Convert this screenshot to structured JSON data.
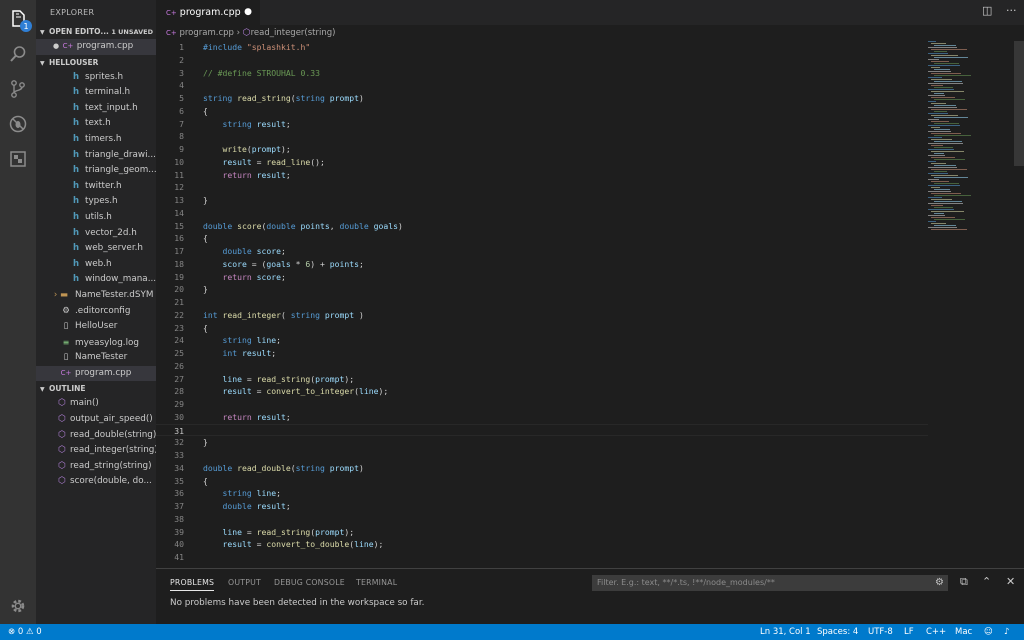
{
  "activity": {
    "explorer_badge": "1",
    "icons": [
      "files-icon",
      "search-icon",
      "source-control-icon",
      "debug-icon",
      "extensions-icon",
      "gear-icon"
    ]
  },
  "sidebar": {
    "title": "EXPLORER",
    "open_editors": {
      "label": "OPEN EDITO...",
      "unsaved": "1 UNSAVED",
      "file": "program.cpp"
    },
    "project": "HELLOUSER",
    "files": [
      {
        "name": "sprites.h",
        "icon": "h"
      },
      {
        "name": "terminal.h",
        "icon": "h"
      },
      {
        "name": "text_input.h",
        "icon": "h"
      },
      {
        "name": "text.h",
        "icon": "h"
      },
      {
        "name": "timers.h",
        "icon": "h"
      },
      {
        "name": "triangle_drawi...",
        "icon": "h"
      },
      {
        "name": "triangle_geom...",
        "icon": "h"
      },
      {
        "name": "twitter.h",
        "icon": "h"
      },
      {
        "name": "types.h",
        "icon": "h"
      },
      {
        "name": "utils.h",
        "icon": "h"
      },
      {
        "name": "vector_2d.h",
        "icon": "h"
      },
      {
        "name": "web_server.h",
        "icon": "h"
      },
      {
        "name": "web.h",
        "icon": "h"
      },
      {
        "name": "window_mana...",
        "icon": "h"
      },
      {
        "name": "NameTester.dSYM",
        "icon": "folder"
      },
      {
        "name": ".editorconfig",
        "icon": "gear"
      },
      {
        "name": "HelloUser",
        "icon": "file"
      },
      {
        "name": "myeasylog.log",
        "icon": "log"
      },
      {
        "name": "NameTester",
        "icon": "file"
      },
      {
        "name": "program.cpp",
        "icon": "cpp"
      }
    ],
    "outline_label": "OUTLINE",
    "outline": [
      "main()",
      "output_air_speed()",
      "read_double(string)",
      "read_integer(string)",
      "read_string(string)",
      "score(double, do..."
    ]
  },
  "tab": {
    "title": "program.cpp"
  },
  "breadcrumb": {
    "file": "program.cpp",
    "symbol": "read_integer(string)"
  },
  "editor": {
    "current_line": 31,
    "lines": [
      [
        [
          "k",
          "#include "
        ],
        [
          "s",
          "\"splashkit.h\""
        ]
      ],
      [],
      [
        [
          "c",
          "// #define STROUHAL 0.33"
        ]
      ],
      [],
      [
        [
          "k",
          "string "
        ],
        [
          "f",
          "read_string"
        ],
        [
          "t",
          "("
        ],
        [
          "k",
          "string "
        ],
        [
          "p",
          "prompt"
        ],
        [
          "t",
          ")"
        ]
      ],
      [
        [
          "t",
          "{"
        ]
      ],
      [
        [
          "t",
          "    "
        ],
        [
          "k",
          "string "
        ],
        [
          "p",
          "result"
        ],
        [
          "t",
          ";"
        ]
      ],
      [],
      [
        [
          "t",
          "    "
        ],
        [
          "f",
          "write"
        ],
        [
          "t",
          "("
        ],
        [
          "p",
          "prompt"
        ],
        [
          "t",
          ");"
        ]
      ],
      [
        [
          "t",
          "    "
        ],
        [
          "p",
          "result"
        ],
        [
          "t",
          " = "
        ],
        [
          "f",
          "read_line"
        ],
        [
          "t",
          "();"
        ]
      ],
      [
        [
          "t",
          "    "
        ],
        [
          "ctl",
          "return "
        ],
        [
          "p",
          "result"
        ],
        [
          "t",
          ";"
        ]
      ],
      [],
      [
        [
          "t",
          "}"
        ]
      ],
      [],
      [
        [
          "k",
          "double "
        ],
        [
          "f",
          "score"
        ],
        [
          "t",
          "("
        ],
        [
          "k",
          "double "
        ],
        [
          "p",
          "points"
        ],
        [
          "t",
          ", "
        ],
        [
          "k",
          "double "
        ],
        [
          "p",
          "goals"
        ],
        [
          "t",
          ")"
        ]
      ],
      [
        [
          "t",
          "{"
        ]
      ],
      [
        [
          "t",
          "    "
        ],
        [
          "k",
          "double "
        ],
        [
          "p",
          "score"
        ],
        [
          "t",
          ";"
        ]
      ],
      [
        [
          "t",
          "    "
        ],
        [
          "p",
          "score"
        ],
        [
          "t",
          " = ("
        ],
        [
          "p",
          "goals"
        ],
        [
          "t",
          " * "
        ],
        [
          "n",
          "6"
        ],
        [
          "t",
          ") + "
        ],
        [
          "p",
          "points"
        ],
        [
          "t",
          ";"
        ]
      ],
      [
        [
          "t",
          "    "
        ],
        [
          "ctl",
          "return "
        ],
        [
          "p",
          "score"
        ],
        [
          "t",
          ";"
        ]
      ],
      [
        [
          "t",
          "}"
        ]
      ],
      [],
      [
        [
          "k",
          "int "
        ],
        [
          "f",
          "read_integer"
        ],
        [
          "t",
          "( "
        ],
        [
          "k",
          "string "
        ],
        [
          "p",
          "prompt"
        ],
        [
          "t",
          " )"
        ]
      ],
      [
        [
          "t",
          "{"
        ]
      ],
      [
        [
          "t",
          "    "
        ],
        [
          "k",
          "string "
        ],
        [
          "p",
          "line"
        ],
        [
          "t",
          ";"
        ]
      ],
      [
        [
          "t",
          "    "
        ],
        [
          "k",
          "int "
        ],
        [
          "p",
          "result"
        ],
        [
          "t",
          ";"
        ]
      ],
      [],
      [
        [
          "t",
          "    "
        ],
        [
          "p",
          "line"
        ],
        [
          "t",
          " = "
        ],
        [
          "f",
          "read_string"
        ],
        [
          "t",
          "("
        ],
        [
          "p",
          "prompt"
        ],
        [
          "t",
          ");"
        ]
      ],
      [
        [
          "t",
          "    "
        ],
        [
          "p",
          "result"
        ],
        [
          "t",
          " = "
        ],
        [
          "f",
          "convert_to_integer"
        ],
        [
          "t",
          "("
        ],
        [
          "p",
          "line"
        ],
        [
          "t",
          ");"
        ]
      ],
      [],
      [
        [
          "t",
          "    "
        ],
        [
          "ctl",
          "return "
        ],
        [
          "p",
          "result"
        ],
        [
          "t",
          ";"
        ]
      ],
      [],
      [
        [
          "t",
          "}"
        ]
      ],
      [],
      [
        [
          "k",
          "double "
        ],
        [
          "f",
          "read_double"
        ],
        [
          "t",
          "("
        ],
        [
          "k",
          "string "
        ],
        [
          "p",
          "prompt"
        ],
        [
          "t",
          ")"
        ]
      ],
      [
        [
          "t",
          "{"
        ]
      ],
      [
        [
          "t",
          "    "
        ],
        [
          "k",
          "string "
        ],
        [
          "p",
          "line"
        ],
        [
          "t",
          ";"
        ]
      ],
      [
        [
          "t",
          "    "
        ],
        [
          "k",
          "double "
        ],
        [
          "p",
          "result"
        ],
        [
          "t",
          ";"
        ]
      ],
      [],
      [
        [
          "t",
          "    "
        ],
        [
          "p",
          "line"
        ],
        [
          "t",
          " = "
        ],
        [
          "f",
          "read_string"
        ],
        [
          "t",
          "("
        ],
        [
          "p",
          "prompt"
        ],
        [
          "t",
          ");"
        ]
      ],
      [
        [
          "t",
          "    "
        ],
        [
          "p",
          "result"
        ],
        [
          "t",
          " = "
        ],
        [
          "f",
          "convert_to_double"
        ],
        [
          "t",
          "("
        ],
        [
          "p",
          "line"
        ],
        [
          "t",
          ");"
        ]
      ],
      []
    ]
  },
  "panel": {
    "tabs": [
      "PROBLEMS",
      "OUTPUT",
      "DEBUG CONSOLE",
      "TERMINAL"
    ],
    "active_tab": "PROBLEMS",
    "filter_placeholder": "Filter. E.g.: text, **/*.ts, !**/node_modules/**",
    "message": "No problems have been detected in the workspace so far."
  },
  "status": {
    "errors": "0",
    "warnings": "0",
    "position": "Ln 31, Col 1",
    "spaces": "Spaces: 4",
    "encoding": "UTF-8",
    "eol": "LF",
    "language": "C++",
    "platform": "Mac"
  },
  "colors": {
    "activity_bar": "#333333",
    "sidebar": "#252526",
    "editor": "#1e1e1e",
    "status_bar": "#007acc",
    "accent": "#2f7fd6"
  }
}
